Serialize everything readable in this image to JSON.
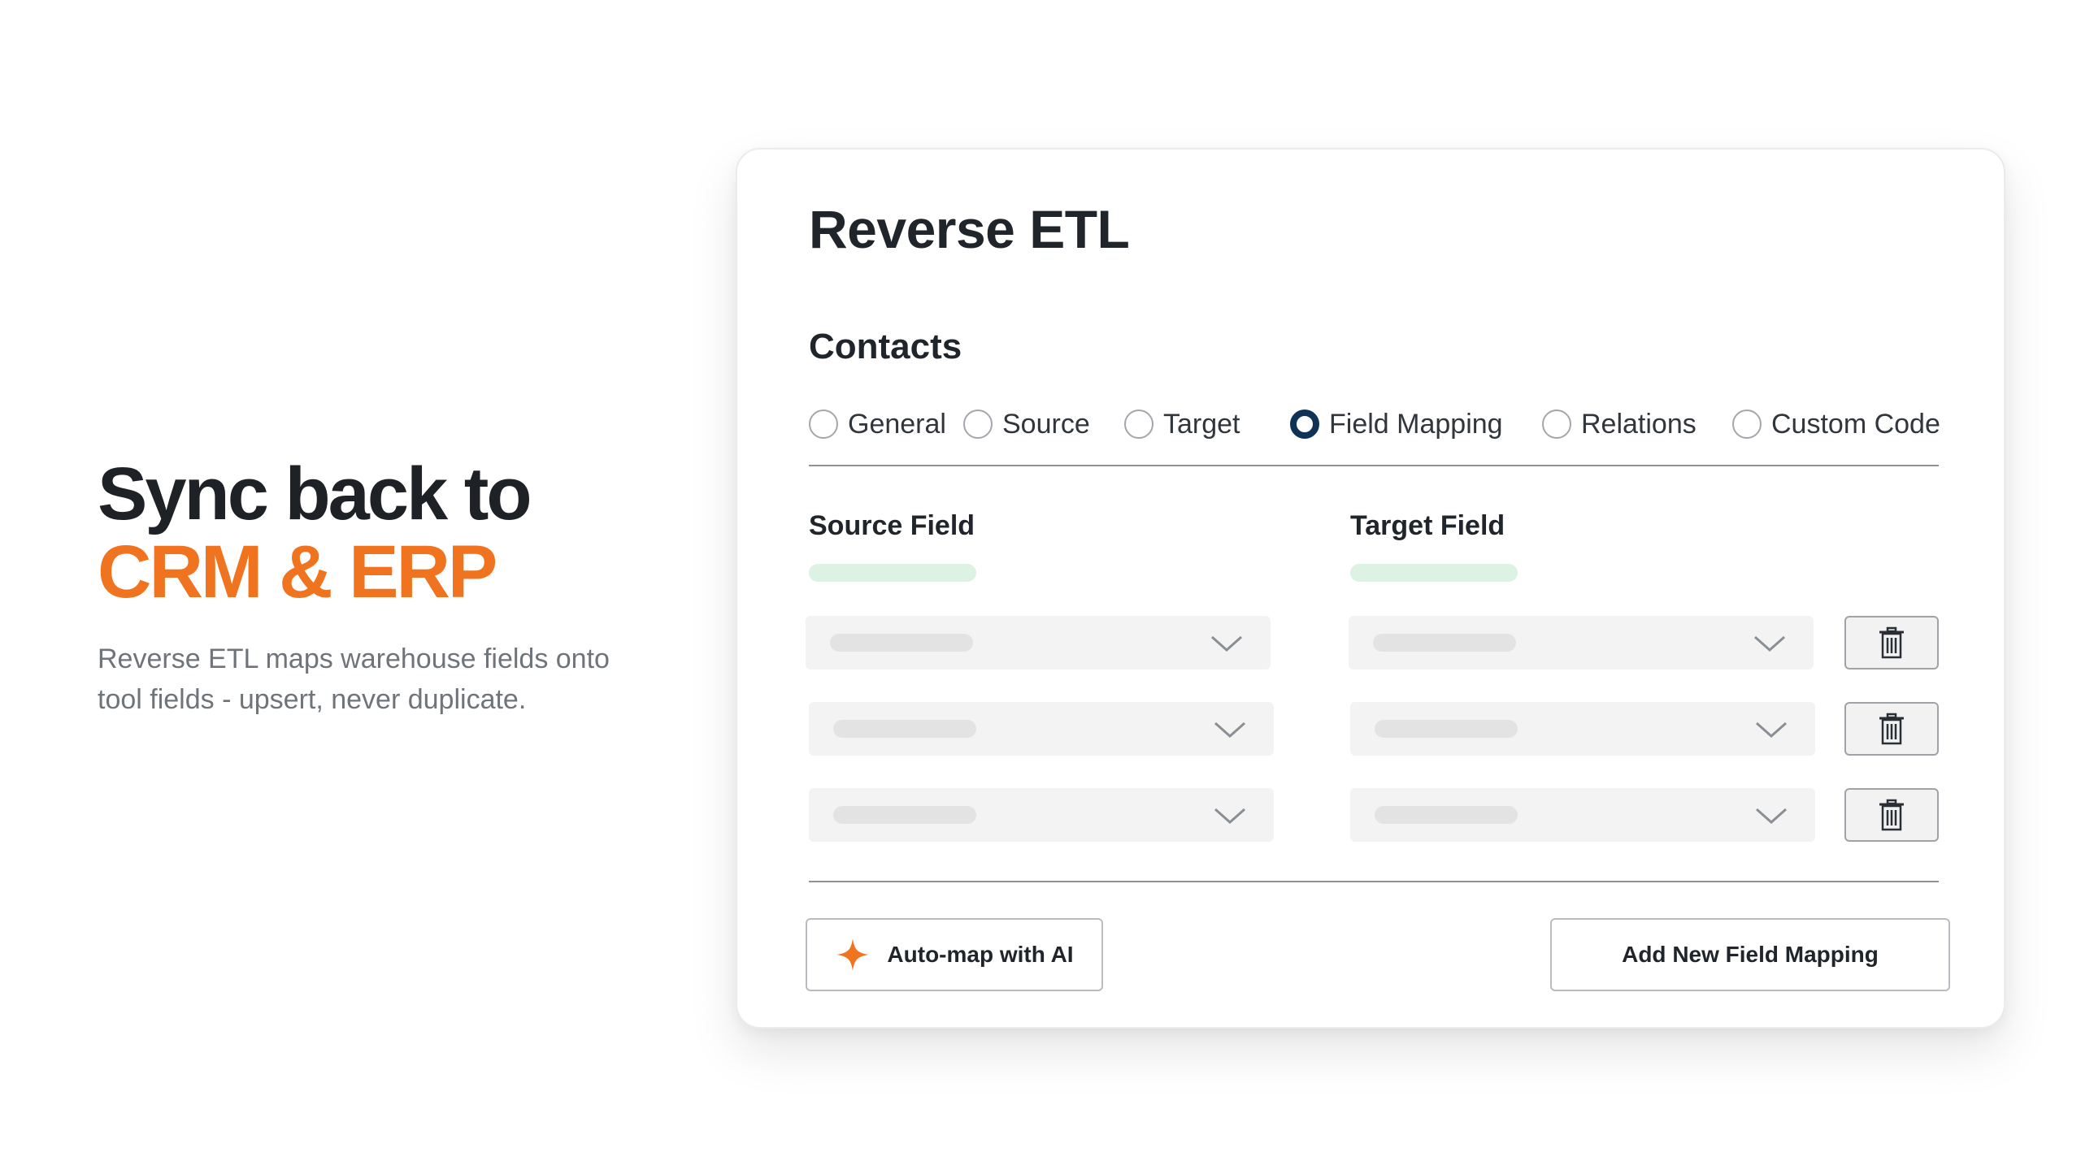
{
  "hero": {
    "heading_line1": "Sync back to",
    "heading_line2": "CRM & ERP",
    "subtext": "Reverse ETL maps warehouse fields onto tool fields - upsert, never duplicate."
  },
  "card": {
    "title": "Reverse ETL",
    "section_title": "Contacts",
    "tabs": [
      {
        "label": "General",
        "selected": false
      },
      {
        "label": "Source",
        "selected": false
      },
      {
        "label": "Target",
        "selected": false
      },
      {
        "label": "Field Mapping",
        "selected": true
      },
      {
        "label": "Relations",
        "selected": false
      },
      {
        "label": "Custom Code",
        "selected": false
      }
    ],
    "mapping": {
      "source_header": "Source Field",
      "target_header": "Target Field",
      "row_count": 3
    },
    "actions": {
      "auto_map_label": "Auto-map with AI",
      "add_label": "Add New Field Mapping"
    }
  },
  "colors": {
    "accent": "#f07320",
    "radio_selected": "#0e3357",
    "header_bar": "#dcf2e2"
  },
  "icons": {
    "dropdown": "chevron-down-icon",
    "delete": "trash-icon",
    "ai": "sparkle-icon"
  }
}
